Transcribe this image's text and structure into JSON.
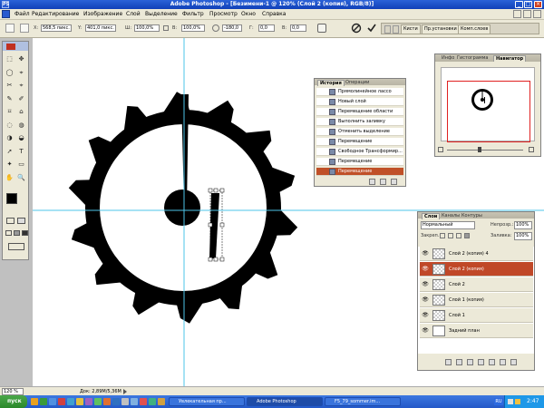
{
  "window": {
    "app": "Adobe Photoshop",
    "document": "[Безимени-1 @ 120% (Слой 2 (копия), RGB/8)]",
    "logo": "PS",
    "controls": [
      "_",
      "□",
      "×"
    ]
  },
  "menu": [
    "Файл",
    "Редактирование",
    "Изображение",
    "Слой",
    "Выделение",
    "Фильтр",
    "Просмотр",
    "Окно",
    "Справка"
  ],
  "options": {
    "x_label": "X:",
    "x_value": "568,5 пикс.",
    "y_label": "Y:",
    "y_value": "401,0 пикс.",
    "w_label": "Ш:",
    "w_value": "100,0%",
    "h_label": "В:",
    "h_value": "100,0%",
    "angle_value": "-180,0",
    "hskew_label": "Г:",
    "hskew_value": "0,0",
    "vskew_label": "В:",
    "vskew_value": "0,0",
    "well_tabs": [
      "Кисти",
      "Пр.установки",
      "Комп.слоев"
    ]
  },
  "tools": [
    [
      "⬚",
      "✥"
    ],
    [
      "◯",
      "⌖"
    ],
    [
      "✂",
      "⌖"
    ],
    [
      "✎",
      "✐"
    ],
    [
      "⌑",
      "⌂"
    ],
    [
      "◌",
      "◍"
    ],
    [
      "◑",
      "◒"
    ],
    [
      "➚",
      "T"
    ],
    [
      "✦",
      "▭"
    ],
    [
      "✋",
      "🔍"
    ]
  ],
  "history": {
    "tabs": [
      "История",
      "Операции"
    ],
    "items": [
      {
        "label": "Прямолинейное лассо",
        "selected": false
      },
      {
        "label": "Новый слой",
        "selected": false
      },
      {
        "label": "Перемещение области",
        "selected": false
      },
      {
        "label": "Выполнить заливку",
        "selected": false
      },
      {
        "label": "Отменить выделение",
        "selected": false
      },
      {
        "label": "Перемещение",
        "selected": false
      },
      {
        "label": "Свободное Трансформир...",
        "selected": false
      },
      {
        "label": "Перемещение",
        "selected": false
      },
      {
        "label": "Перемещение",
        "selected": true
      }
    ]
  },
  "navigator": {
    "tabs": [
      "Инфо",
      "Гистограмма",
      "Навигатор"
    ]
  },
  "layers": {
    "tabs": [
      "Слои",
      "Каналы",
      "Контуры"
    ],
    "blend_mode": "Нормальный",
    "opacity_label": "Непрозр.:",
    "opacity_value": "100%",
    "lock_label": "Закреп.:",
    "fill_label": "Заливка:",
    "fill_value": "100%",
    "rows": [
      {
        "name": "Слой 2 (копия) 4",
        "selected": false
      },
      {
        "name": "Слой 2 (копия)",
        "selected": true
      },
      {
        "name": "Слой 2",
        "selected": false
      },
      {
        "name": "Слой 1 (копия)",
        "selected": false
      },
      {
        "name": "Слой 1",
        "selected": false
      },
      {
        "name": "Задний план",
        "selected": false
      }
    ]
  },
  "status": {
    "zoom": "120 %",
    "doc": "Док: 2,89М/5,36М"
  },
  "taskbar": {
    "start": "пуск",
    "tasks": [
      {
        "label": "Увлекательная пр...",
        "active": false
      },
      {
        "label": "Adobe Photoshop",
        "active": true
      },
      {
        "label": "F5_79_sommer.im...",
        "active": false
      }
    ],
    "lang": "RU",
    "clock": "2:47"
  },
  "colors": {
    "accent_selection": "#c04828",
    "title_bar": "#1f50c8",
    "taskbar": "#2a5ed0",
    "guide": "#4ec4e8",
    "navigator_frame": "#e02020"
  }
}
